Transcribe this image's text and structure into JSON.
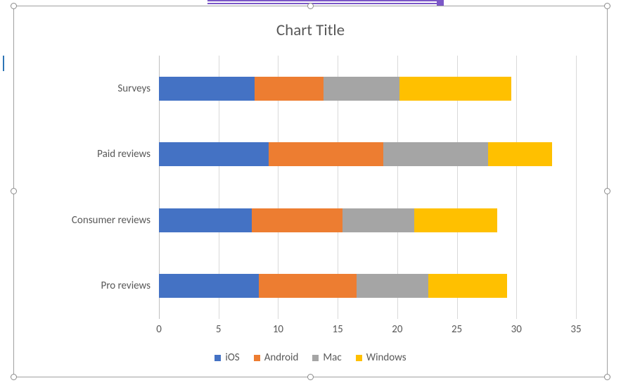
{
  "chart_data": {
    "type": "bar",
    "orientation": "horizontal",
    "stacked": true,
    "title": "Chart Title",
    "xlabel": "",
    "ylabel": "",
    "xlim": [
      0,
      35
    ],
    "xticks": [
      0,
      5,
      10,
      15,
      20,
      25,
      30,
      35
    ],
    "categories": [
      "Pro reviews",
      "Consumer reviews",
      "Paid reviews",
      "Surveys"
    ],
    "series": [
      {
        "name": "iOS",
        "color": "#4472C4",
        "values": [
          8.4,
          7.8,
          9.2,
          8.0
        ]
      },
      {
        "name": "Android",
        "color": "#ED7D31",
        "values": [
          8.2,
          7.6,
          9.6,
          5.8
        ]
      },
      {
        "name": "Mac",
        "color": "#A5A5A5",
        "values": [
          6.0,
          6.0,
          8.8,
          6.4
        ]
      },
      {
        "name": "Windows",
        "color": "#FFC000",
        "values": [
          6.6,
          7.0,
          5.4,
          9.4
        ]
      }
    ],
    "grid": {
      "x": true,
      "y": false
    },
    "legend_position": "bottom"
  }
}
